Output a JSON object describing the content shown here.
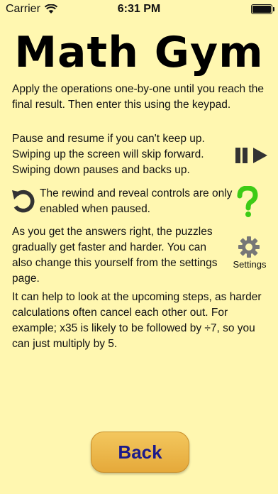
{
  "status": {
    "carrier": "Carrier",
    "time": "6:31 PM"
  },
  "title": "Math Gym",
  "paragraphs": {
    "intro": "Apply the operations one-by-one until you reach the final result. Then enter this using the keypad.",
    "pause": "Pause and resume if you can't keep up. Swiping up the screen will skip forward. Swiping down pauses and backs up.",
    "rewind": "The rewind and reveal controls are only enabled when paused.",
    "settings": "As you get the answers right, the puzzles gradually get faster and harder. You can also change this yourself from the settings page.",
    "tips": "It can help to look at the upcoming steps, as harder calculations often cancel each other out. For example; x35 is likely to be followed by ÷7, so you can just multiply by 5."
  },
  "icons": {
    "playpause": "play-pause-icon",
    "rewind": "rewind-icon",
    "question": "question-mark-icon",
    "gear": "gear-icon",
    "settings_label": "Settings"
  },
  "back_button": {
    "label": "Back"
  },
  "colors": {
    "background": "#FFF7B0",
    "button": "#EDB84A",
    "button_text": "#1B1A8A",
    "question": "#3DCB16"
  }
}
